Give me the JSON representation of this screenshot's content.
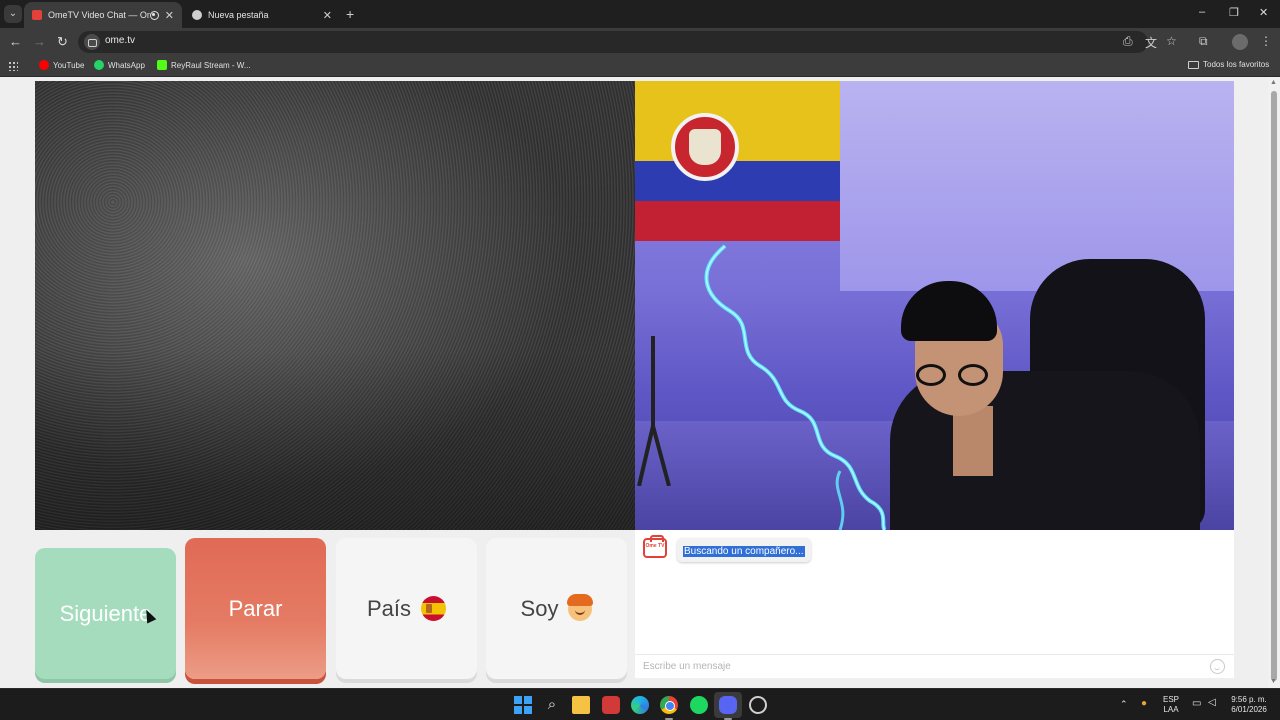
{
  "browser": {
    "tabs": [
      {
        "label": "OmeTV Video Chat — Ome",
        "active": true
      },
      {
        "label": "Nueva pestaña",
        "active": false
      }
    ],
    "url": "ome.tv",
    "bookmarks": [
      {
        "label": "YouTube",
        "icon": "youtube-icon",
        "color": "#ff0000"
      },
      {
        "label": "WhatsApp",
        "icon": "whatsapp-icon",
        "color": "#25d366"
      },
      {
        "label": "ReyRaul Stream - W...",
        "icon": "kick-icon",
        "color": "#53fc18"
      }
    ],
    "all_bookmarks": "Todos los favoritos"
  },
  "controls": {
    "next": "Siguiente",
    "stop": "Parar",
    "country": "País",
    "gender": "Soy"
  },
  "chat": {
    "logo_text": "Ome TV",
    "status_message": "Buscando un compañero...",
    "input_placeholder": "Escribe un mensaje"
  },
  "taskbar": {
    "language": "ESP",
    "layout": "LAA",
    "time": "9:56 p. m.",
    "date": "6/01/2026"
  },
  "colors": {
    "next_button": "#a4dcbd",
    "stop_button": "#e06a55",
    "selection": "#2f6fd6",
    "browser_toolbar": "#3c3c3c"
  }
}
